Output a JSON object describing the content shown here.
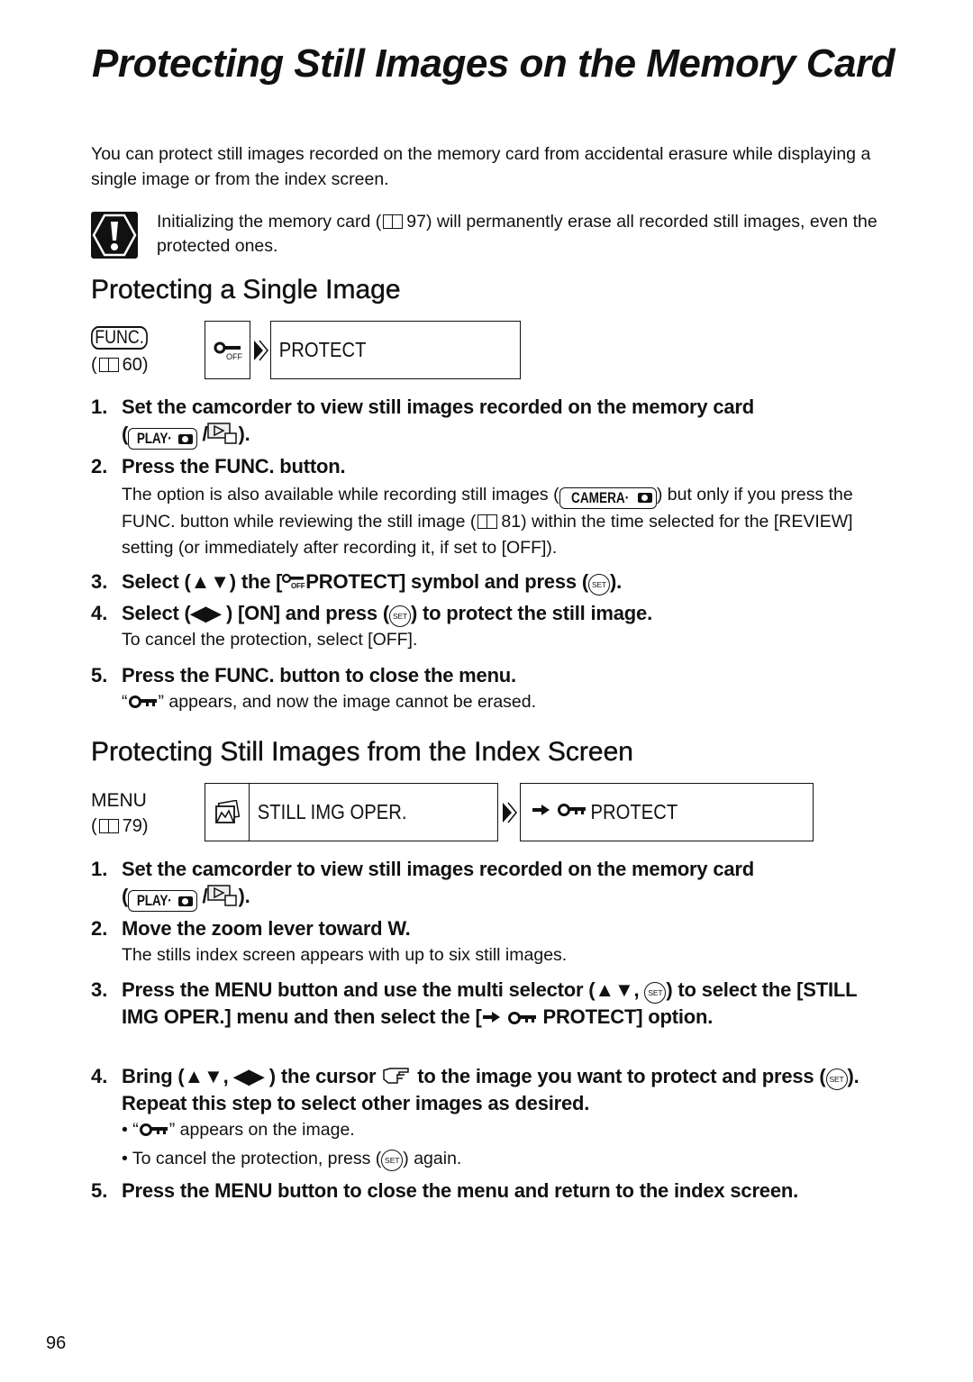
{
  "page": {
    "title": "Protecting Still Images on the Memory Card",
    "intro": "You can protect still images recorded on the memory card from accidental erasure while displaying a single image or from the index screen.",
    "caution": {
      "icon": "caution-icon",
      "text": "Initializing the memory card (  97) will permanently erase all recorded still images, even the protected ones.",
      "text_before": "Initializing the memory card (",
      "ref": "97",
      "text_after": ") will permanently erase all recorded still images, even the protected ones."
    },
    "page_number": "96"
  },
  "section1": {
    "heading": "Protecting a Single Image",
    "button": "FUNC.",
    "ref": "60",
    "menu_path": {
      "icon": "protect-off-icon",
      "item": "PROTECT"
    },
    "steps": [
      {
        "num": "1.",
        "text_a": "Set the camcorder to view still images recorded on the memory card",
        "mode_label": "PLAY·",
        "text_b": ")."
      },
      {
        "num": "2.",
        "text": "Press the FUNC. button.",
        "sub_a": "The option is also available while recording still images (",
        "mode_label": "CAMERA·",
        "sub_b": ") but only if you press the FUNC. button while reviewing the still image (",
        "ref": "81",
        "sub_c": ") within the time selected for the [REVIEW] setting (or immediately after recording it, if set to [OFF])."
      },
      {
        "num": "3.",
        "text_a": "Select (▲▼) the [",
        "text_b": "PROTECT] symbol and press (",
        "text_c": ")."
      },
      {
        "num": "4.",
        "text_a": "Select (◀▶ ) [ON] and press (",
        "text_b": ") to protect the still image.",
        "sub": "To cancel the protection, select [OFF]."
      },
      {
        "num": "5.",
        "text": "Press the FUNC. button to close the menu.",
        "sub_a": "“",
        "sub_b": "” appears, and now the image cannot be erased."
      }
    ]
  },
  "section2": {
    "heading": "Protecting Still Images from the Index Screen",
    "button": "MENU",
    "ref": "79",
    "menu_path": {
      "menu_icon": "still-image-icon",
      "menu_item": "STILL IMG OPER.",
      "option_item": "PROTECT"
    },
    "steps": [
      {
        "num": "1.",
        "text_a": "Set the camcorder to view still images recorded on the memory card",
        "mode_label": "PLAY·",
        "text_b": ")."
      },
      {
        "num": "2.",
        "text": "Move the zoom lever toward W.",
        "sub": "The stills index screen appears with up to six still images."
      },
      {
        "num": "3.",
        "text_a": "Press the MENU button and use the multi selector (▲▼, ",
        "text_b": ") to select the [STILL IMG OPER.] menu and then select the [",
        "text_c": "PROTECT] option."
      },
      {
        "num": "4.",
        "text_a": "Bring (▲▼, ◀▶ ) the cursor ",
        "text_b": " to the image you want to protect and press (",
        "text_c": "). Repeat this step to select other images as desired.",
        "bullets": [
          {
            "a": "• “",
            "b": "” appears on the image."
          },
          {
            "a": "• To cancel the protection, press (",
            "b": ") again."
          }
        ]
      },
      {
        "num": "5.",
        "text": "Press the MENU button to close the menu and return to the index screen."
      }
    ]
  },
  "labels": {
    "set": "SET",
    "off": "OFF",
    "open_paren": "(",
    "slash": "/"
  }
}
